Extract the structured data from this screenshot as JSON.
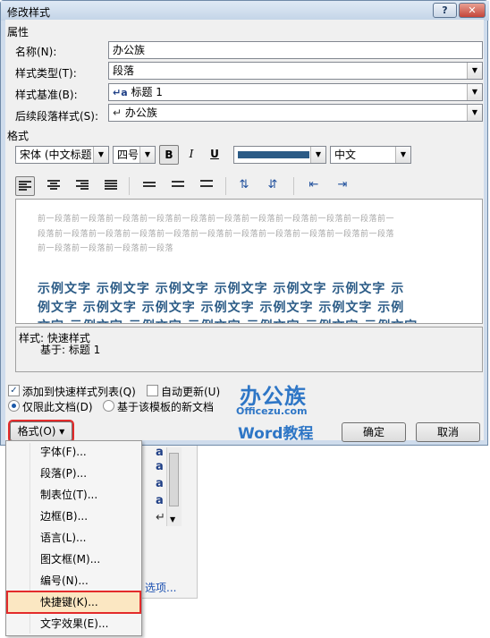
{
  "window": {
    "title": "修改样式",
    "help_label": "?",
    "close_label": "✕"
  },
  "properties": {
    "section_label": "属性",
    "name_label": "名称(N):",
    "name_value": "办公族",
    "style_type_label": "样式类型(T):",
    "style_type_value": "段落",
    "based_on_label": "样式基准(B):",
    "based_on_value": "标题 1",
    "based_on_icon": "↵a",
    "next_style_label": "后续段落样式(S):",
    "next_style_value": "办公族",
    "next_style_icon": "↵"
  },
  "format": {
    "section_label": "格式",
    "font_value": "宋体 (中文标题",
    "size_value": "四号",
    "bold_label": "B",
    "italic_label": "I",
    "underline_label": "U",
    "color_value": "#2b5b86",
    "language_value": "中文"
  },
  "preview": {
    "gray_lines": [
      "前一段落前一段落前一段落前一段落前一段落前一段落前一段落前一段落前一段落前一段落前一",
      "段落前一段落前一段落前一段落前一段落前一段落前一段落前一段落前一段落前一段落前一段落",
      "前一段落前一段落前一段落前一段落"
    ],
    "sample_lines": [
      "示例文字 示例文字 示例文字 示例文字 示例文字 示例文字 示",
      "例文字 示例文字 示例文字 示例文字 示例文字 示例文字 示例",
      "文字 示例文字 示例文字 示例文字 示例文字 示例文字 示例文字"
    ]
  },
  "description": {
    "line1": "样式: 快速样式",
    "line2": "基于: 标题 1"
  },
  "options": {
    "add_to_quick_label": "添加到快速样式列表(Q)",
    "auto_update_label": "自动更新(U)",
    "only_this_doc_label": "仅限此文档(D)",
    "new_docs_template_label": "基于该模板的新文档"
  },
  "buttons": {
    "format_label": "格式(O) ▾",
    "ok_label": "确定",
    "cancel_label": "取消"
  },
  "watermark": {
    "line1": "办公族",
    "line2": "Officezu.com",
    "line3": "Word教程"
  },
  "background": {
    "link_text": "选项..."
  },
  "menu": {
    "items": [
      "字体(F)...",
      "段落(P)...",
      "制表位(T)...",
      "边框(B)...",
      "语言(L)...",
      "图文框(M)...",
      "编号(N)...",
      "快捷键(K)...",
      "文字效果(E)..."
    ],
    "selected_index": 7
  }
}
